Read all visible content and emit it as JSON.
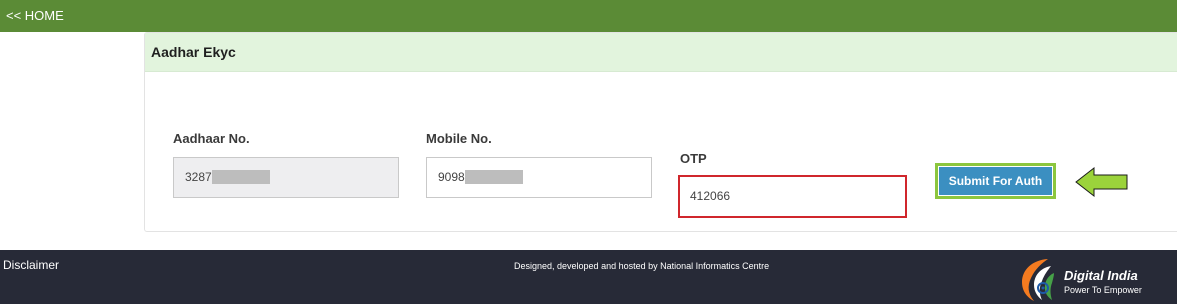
{
  "nav": {
    "home_link": "<< HOME"
  },
  "panel": {
    "title": "Aadhar Ekyc"
  },
  "form": {
    "aadhaar": {
      "label": "Aadhaar No.",
      "value": "3287"
    },
    "mobile": {
      "label": "Mobile No.",
      "value": "9098"
    },
    "otp": {
      "label": "OTP",
      "value": "412066"
    },
    "submit_label": "Submit For Auth"
  },
  "footer": {
    "disclaimer": "Disclaimer",
    "credit": "Designed, developed and hosted by National Informatics Centre",
    "logo_title": "Digital India",
    "logo_tagline": "Power To Empower"
  },
  "colors": {
    "nav_bar": "#5b8b36",
    "panel_header": "#e2f4dd",
    "otp_highlight": "#d0262c",
    "submit_button": "#3b8fc1",
    "submit_highlight": "#8cc63e",
    "footer": "#272a37"
  },
  "icons": {
    "arrow": "left-arrow-icon",
    "logo": "digital-india-logo"
  }
}
